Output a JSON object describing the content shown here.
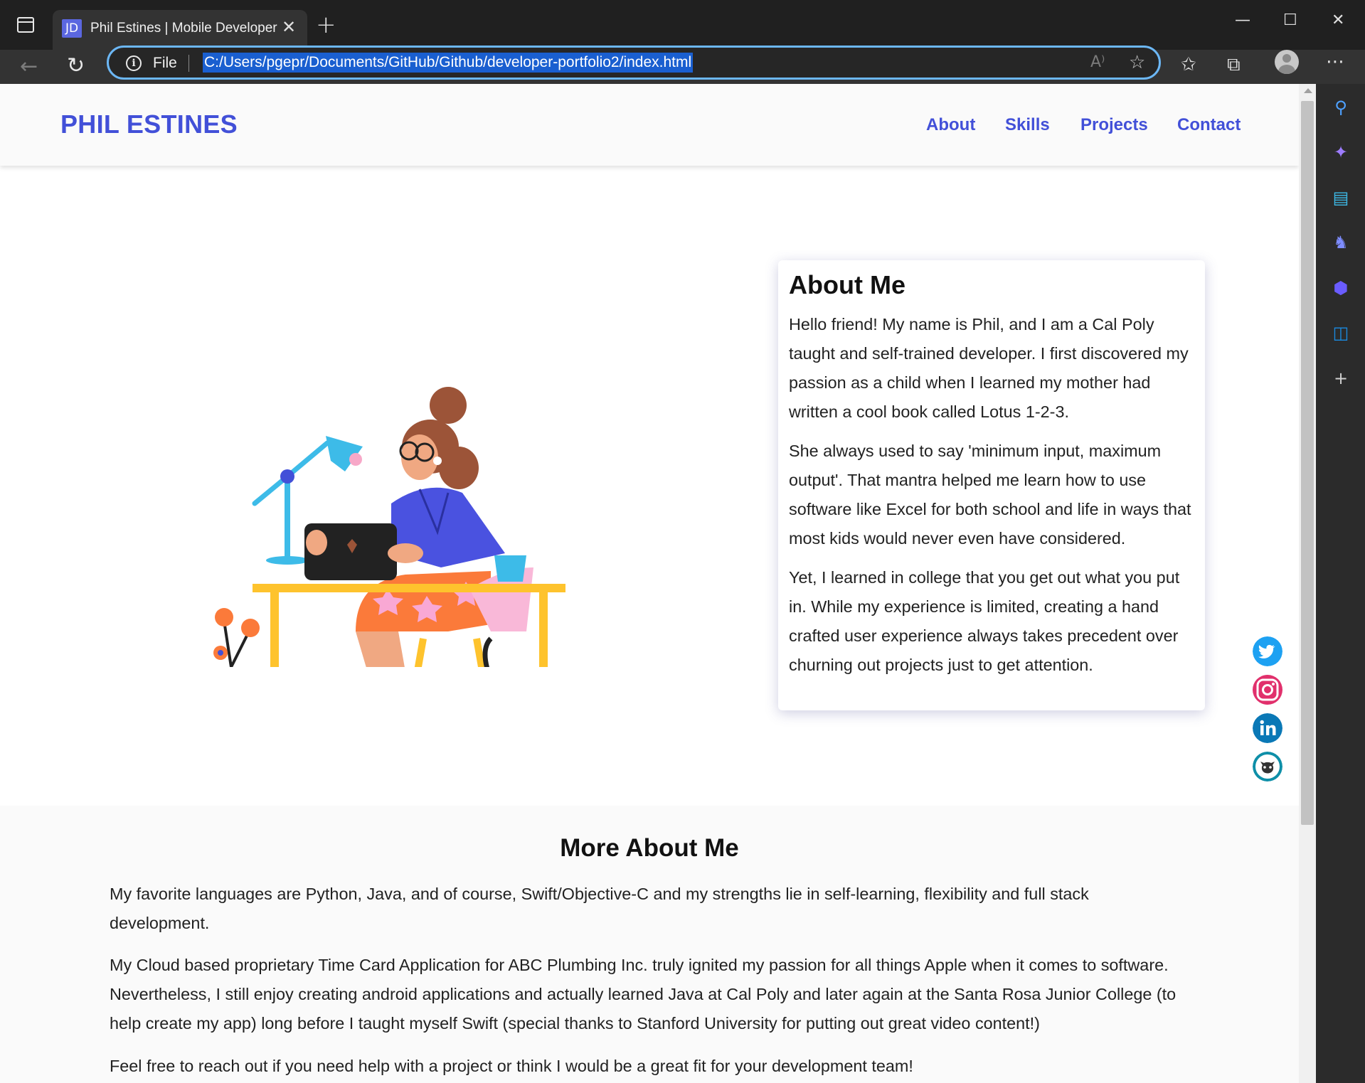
{
  "browser": {
    "tab_favicon": "JD",
    "tab_title": "Phil Estines | Mobile Developer",
    "close_glyph": "✕",
    "newtab_glyph": "+",
    "file_label": "File",
    "url": "C:/Users/pgepr/Documents/GitHub/Github/developer-portfolio2/index.html",
    "read_aloud_glyph": "A⁾",
    "window_buttons": [
      "—",
      "☐",
      "✕"
    ]
  },
  "site": {
    "brand": "PHIL ESTINES",
    "nav": [
      "About",
      "Skills",
      "Projects",
      "Contact"
    ],
    "accent": "#4250d8"
  },
  "about": {
    "title": "About Me",
    "paragraphs": [
      "Hello friend! My name is Phil, and I am a Cal Poly taught and self-trained developer. I first discovered my passion as a child when I learned my mother had written a cool book called Lotus 1-2-3.",
      "She always used to say 'minimum input, maximum output'. That mantra helped me learn how to use software like Excel for both school and life in ways that most kids would never even have considered.",
      "Yet, I learned in college that you get out what you put in. While my experience is limited, creating a hand crafted user experience always takes precedent over churning out projects just to get attention."
    ]
  },
  "social_icons": [
    "twitter-icon",
    "instagram-icon",
    "linkedin-icon",
    "github-icon"
  ],
  "more": {
    "title": "More About Me",
    "paragraphs": [
      "My favorite languages are Python, Java, and of course, Swift/Objective-C and my strengths lie in self-learning, flexibility and full stack development.",
      "My Cloud based proprietary Time Card Application for ABC Plumbing Inc. truly ignited my passion for all things Apple when it comes to software. Nevertheless, I still enjoy creating android applications and actually learned Java at Cal Poly and later again at the Santa Rosa Junior College (to help create my app) long before I taught myself Swift (special thanks to Stanford University for putting out great video content!)",
      "Feel free to reach out if you need help with a project or think I would be a great fit for your development team!"
    ]
  }
}
